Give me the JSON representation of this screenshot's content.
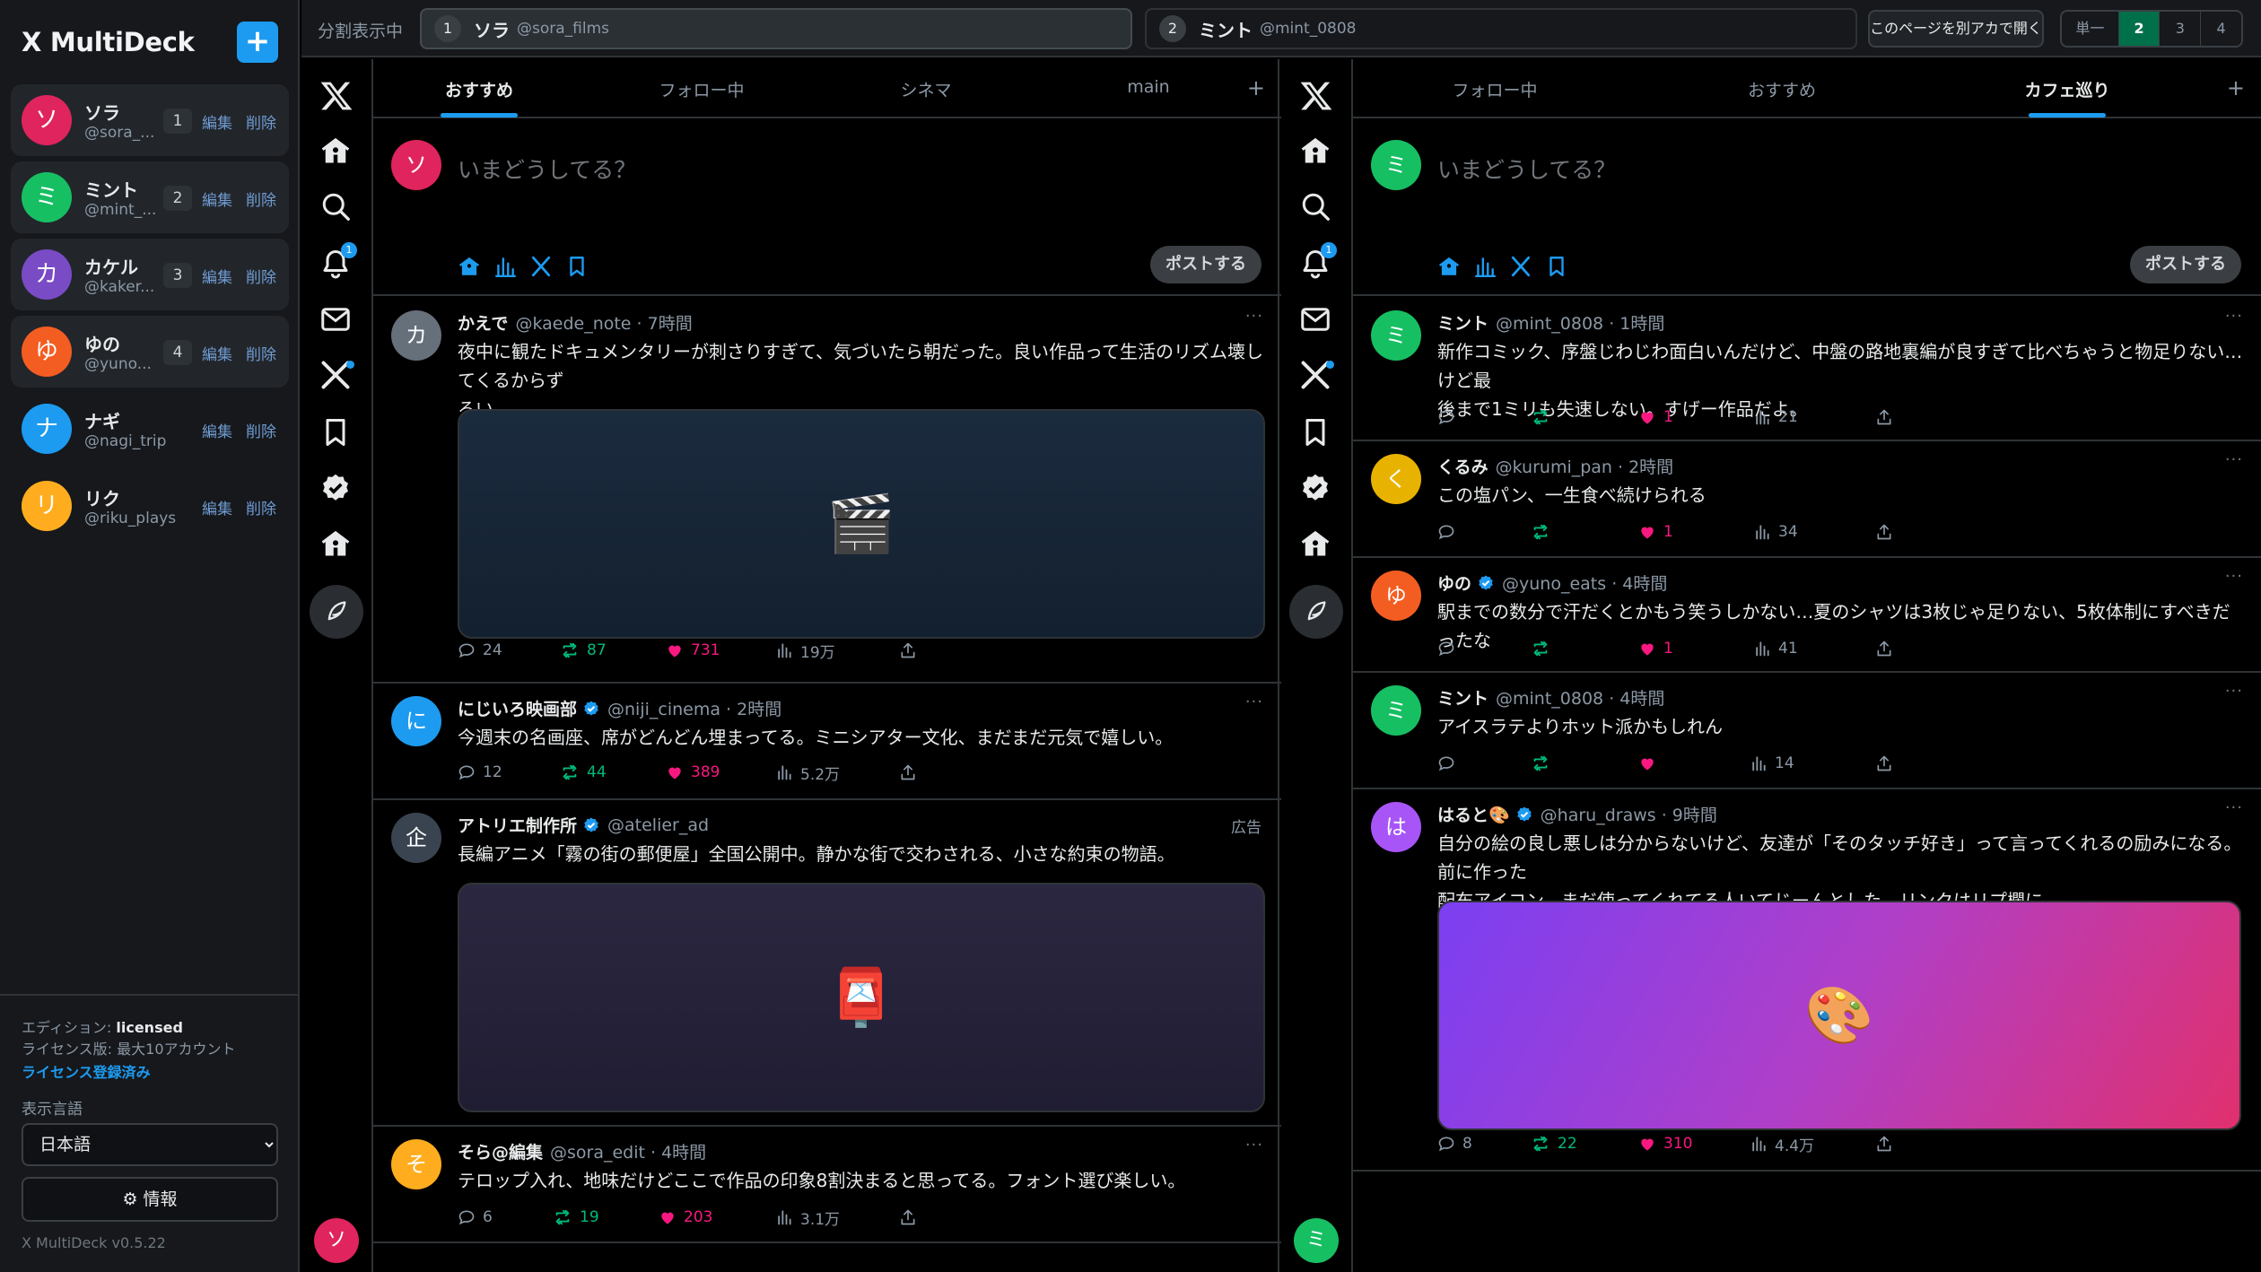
{
  "sidebar": {
    "title": "X MultiDeck",
    "add_label": "+",
    "accounts": [
      {
        "name": "ソラ",
        "handle": "@sora_...",
        "num": "1",
        "edit": "編集",
        "delete": "削除",
        "initial": "ソ",
        "color": "#e0245e"
      },
      {
        "name": "ミント",
        "handle": "@mint_...",
        "num": "2",
        "edit": "編集",
        "delete": "削除",
        "initial": "ミ",
        "color": "#17bf63"
      },
      {
        "name": "カケル",
        "handle": "@kaker...",
        "num": "3",
        "edit": "編集",
        "delete": "削除",
        "initial": "カ",
        "color": "#794bc4"
      },
      {
        "name": "ゆの",
        "handle": "@yuno...",
        "num": "4",
        "edit": "編集",
        "delete": "削除",
        "initial": "ゆ",
        "color": "#f45d22"
      },
      {
        "name": "ナギ",
        "handle": "@nagi_trip",
        "num": "",
        "edit": "編集",
        "delete": "削除",
        "initial": "ナ",
        "color": "#1d9bf0"
      },
      {
        "name": "リク",
        "handle": "@riku_plays",
        "num": "",
        "edit": "編集",
        "delete": "削除",
        "initial": "リ",
        "color": "#ffad1f"
      }
    ],
    "edition_label": "エディション:",
    "edition_value": "licensed",
    "license_limit": "ライセンス版: 最大10アカウント",
    "license_status": "ライセンス登録済み",
    "lang_label": "表示言語",
    "lang_value": "日本語",
    "info_label": "⚙ 情報",
    "version": "X MultiDeck v0.5.22"
  },
  "topbar": {
    "split_label": "分割表示中",
    "slot1": {
      "num": "1",
      "name": "ソラ",
      "handle": "@sora_films"
    },
    "slot2": {
      "num": "2",
      "name": "ミント",
      "handle": "@mint_0808"
    },
    "open_label": "このページを別アカで開く",
    "layouts": [
      "単一",
      "2",
      "3",
      "4"
    ],
    "active_layout": "2"
  },
  "pane1": {
    "tabs": [
      "おすすめ",
      "フォロー中",
      "シネマ",
      "main"
    ],
    "active_tab": "おすすめ",
    "tab_add": "+",
    "composer_initial": "ソ",
    "composer_color": "#e0245e",
    "placeholder": "いまどうしてる？",
    "post_label": "ポストする",
    "me_initial": "ソ",
    "me_color": "#e0245e",
    "notif_badge": "1",
    "tweets": [
      {
        "initial": "カ",
        "color": "#66707a",
        "name": "かえで",
        "handle": "@kaede_note · 7時間",
        "verified": false,
        "text1": "夜中に観たドキュメンタリーが刺さりすぎて、気づいたら朝だった。良い作品って生活のリズム壊してくるからず",
        "text2": "るい。",
        "media_emoji": "🎬",
        "replies": "24",
        "retweets": "87",
        "likes": "731",
        "views": "19万"
      },
      {
        "initial": "に",
        "color": "#1d9bf0",
        "name": "にじいろ映画部",
        "handle": "@niji_cinema · 2時間",
        "verified": true,
        "text1": "今週末の名画座、席がどんどん埋まってる。ミニシアター文化、まだまだ元気で嬉しい。",
        "replies": "12",
        "retweets": "44",
        "likes": "389",
        "views": "5.2万"
      },
      {
        "initial": "企",
        "color": "#3a4450",
        "name": "アトリエ制作所",
        "handle": "@atelier_ad",
        "verified": true,
        "ad": "広告",
        "text1": "長編アニメ「霧の街の郵便屋」全国公開中。静かな街で交わされる、小さな約束の物語。",
        "media_emoji": "📮"
      },
      {
        "initial": "そ",
        "color": "#ffad1f",
        "name": "そら@編集",
        "handle": "@sora_edit · 4時間",
        "verified": false,
        "text1": "テロップ入れ、地味だけどここで作品の印象8割決まると思ってる。フォント選び楽しい。",
        "replies": "6",
        "retweets": "19",
        "likes": "203",
        "views": "3.1万"
      }
    ]
  },
  "pane2": {
    "tabs": [
      "フォロー中",
      "おすすめ",
      "カフェ巡り"
    ],
    "active_tab": "カフェ巡り",
    "tab_add": "+",
    "composer_initial": "ミ",
    "composer_color": "#17bf63",
    "placeholder": "いまどうしてる？",
    "post_label": "ポストする",
    "me_initial": "ミ",
    "me_color": "#17bf63",
    "notif_badge": "1",
    "tweets": [
      {
        "initial": "ミ",
        "color": "#17bf63",
        "name": "ミント",
        "handle": "@mint_0808 · 1時間",
        "verified": false,
        "text1": "新作コミック、序盤じわじわ面白いんだけど、中盤の路地裏編が良すぎて比べちゃうと物足りない…けど最",
        "text2": "後まで1ミリも失速しない。すげー作品だよ。",
        "replies": "",
        "retweets": "",
        "likes": "1",
        "views": "21"
      },
      {
        "initial": "く",
        "color": "#e8b300",
        "name": "くるみ",
        "handle": "@kurumi_pan · 2時間",
        "verified": false,
        "text1": "この塩パン、一生食べ続けられる",
        "replies": "",
        "retweets": "",
        "likes": "1",
        "views": "34"
      },
      {
        "initial": "ゆ",
        "color": "#f45d22",
        "name": "ゆの",
        "handle": "@yuno_eats · 4時間",
        "verified": true,
        "text1": "駅までの数分で汗だくとかもう笑うしかない…夏のシャツは3枚じゃ足りない、5枚体制にすべきだったな",
        "replies": "",
        "retweets": "",
        "likes": "1",
        "views": "41"
      },
      {
        "initial": "ミ",
        "color": "#17bf63",
        "name": "ミント",
        "handle": "@mint_0808 · 4時間",
        "verified": false,
        "text1": "アイスラテよりホット派かもしれん",
        "replies": "",
        "retweets": "",
        "likes": "",
        "views": "14"
      },
      {
        "initial": "は",
        "color": "#a855f7",
        "name": "はると🎨",
        "handle": "@haru_draws · 9時間",
        "verified": true,
        "text1": "自分の絵の良し悪しは分からないけど、友達が「そのタッチ好き」って言ってくれるの励みになる。前に作った",
        "text2": "配布アイコン、まだ使ってくれてる人いてじーんとした。リンクはリプ欄に。",
        "media_emoji": "🎨",
        "replies": "8",
        "retweets": "22",
        "likes": "310",
        "views": "4.4万"
      }
    ]
  }
}
